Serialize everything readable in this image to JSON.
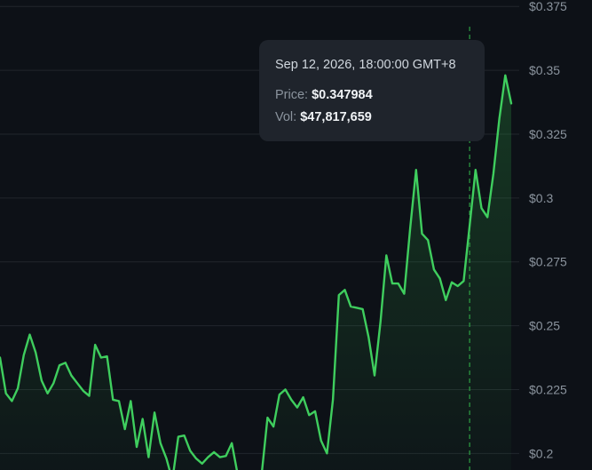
{
  "tooltip": {
    "timestamp": "Sep 12, 2026, 18:00:00 GMT+8",
    "price_label": "Price:",
    "price_value": "$0.347984",
    "vol_label": "Vol:",
    "vol_value": "$47,817,659"
  },
  "colors": {
    "background": "#0d1117",
    "line": "#3fce5e",
    "grid": "#21262d",
    "crosshair": "#2ea043",
    "tick_text": "#8b949e",
    "tooltip_bg": "#1f242c"
  },
  "chart_data": {
    "type": "area",
    "y_axis_position": "right",
    "ylim": [
      0.1935,
      0.3775
    ],
    "y_ticks": [
      0.375,
      0.35,
      0.325,
      0.3,
      0.275,
      0.25,
      0.225,
      0.2
    ],
    "y_tick_labels": [
      "$0.375",
      "$0.35",
      "$0.325",
      "$0.3",
      "$0.275",
      "$0.25",
      "$0.225",
      "$0.2"
    ],
    "grid": true,
    "highlight_index": 79,
    "highlight_value": 0.347984,
    "series": [
      {
        "values": [
          0.2375,
          0.2235,
          0.2205,
          0.2255,
          0.2385,
          0.2465,
          0.2395,
          0.2285,
          0.2235,
          0.2275,
          0.2345,
          0.2355,
          0.2305,
          0.2275,
          0.2245,
          0.2225,
          0.2425,
          0.2375,
          0.238,
          0.221,
          0.2205,
          0.2095,
          0.2205,
          0.2025,
          0.2135,
          0.1985,
          0.216,
          0.204,
          0.198,
          0.1895,
          0.2065,
          0.207,
          0.201,
          0.198,
          0.196,
          0.1985,
          0.2005,
          0.1985,
          0.199,
          0.204,
          0.1915,
          0.1915,
          0.1925,
          0.1875,
          0.1915,
          0.214,
          0.2105,
          0.223,
          0.225,
          0.221,
          0.218,
          0.222,
          0.215,
          0.2165,
          0.205,
          0.2,
          0.221,
          0.262,
          0.264,
          0.2575,
          0.257,
          0.2565,
          0.2455,
          0.2305,
          0.2515,
          0.2775,
          0.2665,
          0.2665,
          0.2625,
          0.288,
          0.311,
          0.286,
          0.2835,
          0.272,
          0.2685,
          0.26,
          0.267,
          0.2655,
          0.2675,
          0.289,
          0.311,
          0.296,
          0.2925,
          0.3095,
          0.331,
          0.348,
          0.337
        ]
      }
    ]
  }
}
